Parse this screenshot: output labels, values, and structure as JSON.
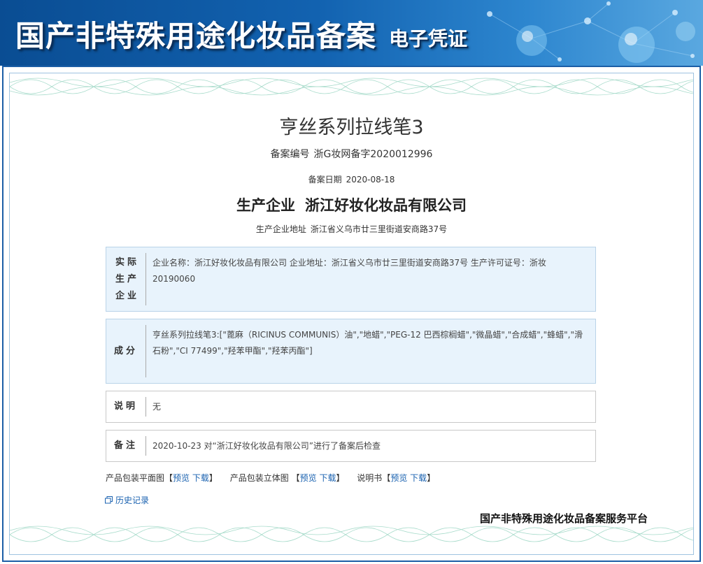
{
  "banner": {
    "title": "国产非特殊用途化妆品备案",
    "subtitle": "电子凭证"
  },
  "certificate": {
    "product_name": "亨丝系列拉线笔3",
    "reg_no_label": "备案编号",
    "reg_no": "浙G妆网备字2020012996",
    "reg_date_label": "备案日期",
    "reg_date": "2020-08-18",
    "company_label": "生产企业",
    "company": "浙江好妆化妆品有限公司",
    "address_label": "生产企业地址",
    "address": "浙江省义乌市廿三里街道安商路37号"
  },
  "sections": {
    "actual_producer": {
      "label_1": "实际",
      "label_2": "生产",
      "label_3": "企业",
      "content": "企业名称：浙江好妆化妆品有限公司 企业地址：浙江省义乌市廿三里街道安商路37号 生产许可证号：浙妆20190060"
    },
    "ingredients": {
      "label": "成分",
      "content": "亨丝系列拉线笔3:[\"蓖麻（RICINUS COMMUNIS）油\",\"地蜡\",\"PEG-12 巴西棕榈蜡\",\"微晶蜡\",\"合成蜡\",\"蜂蜡\",\"滑石粉\",\"CI 77499\",\"羟苯甲酯\",\"羟苯丙酯\"]"
    },
    "description": {
      "label": "说明",
      "content": "无"
    },
    "remarks": {
      "label": "备注",
      "content": "2020-10-23 对“浙江好妆化妆品有限公司”进行了备案后检查"
    }
  },
  "links": {
    "flat_label": "产品包装平面图",
    "solid_label": "产品包装立体图",
    "manual_label": "说明书",
    "bracket_open": "【",
    "bracket_close": "】",
    "preview": "预览",
    "download": "下载"
  },
  "history": {
    "label": "历史记录",
    "icon": "window-restore-icon"
  },
  "footer": {
    "platform": "国产非特殊用途化妆品备案服务平台"
  },
  "colors": {
    "banner_blue": "#1262b0",
    "frame_blue": "#1b5ea6",
    "box_fill": "#e8f3fc",
    "link": "#1a62b0"
  }
}
